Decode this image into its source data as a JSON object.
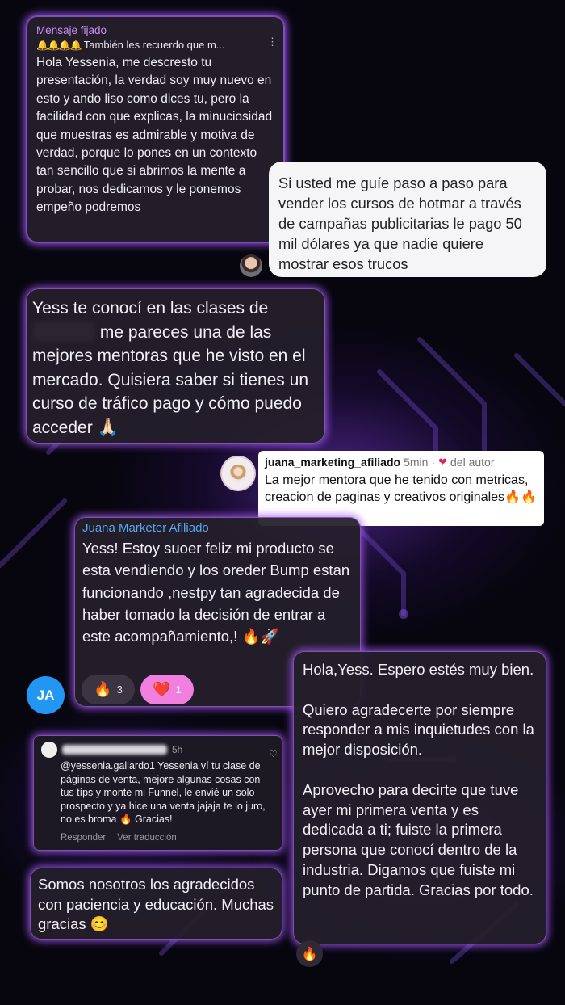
{
  "pinned": {
    "header": "Mensaje fijado",
    "bells": "🔔🔔🔔🔔",
    "preview": "También les recuerdo que m...",
    "more_icon": "⋮",
    "body": "Hola Yessenia, me descresto tu presentación, la verdad soy muy nuevo en esto y ando liso como dices tu, pero la facilidad con que explicas, la minuciosidad que muestras es admirable y motiva de verdad, porque lo pones en un contexto tan sencillo que si abrimos la mente a probar, nos dedicamos y le ponemos empeño podremos"
  },
  "question": {
    "text": "Si usted me guíe paso a paso para vender los cursos de hotmar a través de campañas publicitarias le pago 50 mil dólares ya que nadie quiere mostrar esos trucos"
  },
  "yess_message": {
    "before": "Yess te conocí en las clases de",
    "after": " me pareces una de las mejores mentoras que he visto en el mercado. Quisiera saber si tienes un curso de tráfico pago y cómo puedo acceder 🙏🏻"
  },
  "juana_comment": {
    "username": "juana_marketing_afiliado",
    "time": "5min",
    "dot": "·",
    "heart": "❤",
    "author_label": "del autor",
    "body": "La mejor mentora que he tenido con metricas, creacion de paginas y creativos originales🔥🔥"
  },
  "juana_message": {
    "name": "Juana Marketer Afiliado",
    "body": "Yess! Estoy suoer feliz mi producto se esta vendiendo y los oreder Bump estan funcionando ,nestpy tan agradecida de haber tomado la decisión de entrar a este acompañamiento,! 🔥🚀",
    "avatar_initials": "JA",
    "reactions": [
      {
        "emoji": "🔥",
        "count": "3"
      },
      {
        "emoji": "❤️",
        "count": "1"
      }
    ]
  },
  "hola_message": {
    "paragraphs": [
      "Hola,Yess. Espero estés muy bien.",
      "Quiero agradecerte por siempre responder a mis inquietudes con la mejor disposición.",
      "Aprovecho para decirte que tuve ayer mi primera venta y es dedicada a ti; fuiste la primera persona que conocí dentro de la industria. Digamos que fuiste mi punto de partida. Gracias por todo."
    ],
    "reaction": "🔥"
  },
  "yt_comment": {
    "time": "5h",
    "body": "@yessenia.gallardo1 Yessenia ví tu clase de páginas de venta, mejore algunas cosas con tus típs y monte mi Funnel, le envié un solo prospecto y ya hice una venta jajaja te lo juro, no es broma 🔥 Gracias!",
    "reply_label": "Responder",
    "translate_label": "Ver traducción",
    "heart": "♡"
  },
  "reply_message": {
    "text": "Somos nosotros los agradecidos con paciencia y educación. Muchas gracias 😊"
  },
  "colors": {
    "glow": "#aa5aff",
    "bubble": "#241f2c",
    "pinned_title": "#c98cf2",
    "juana_name": "#5aa8ef",
    "avatar_blue": "#2196f3",
    "heart_reaction": "#f07fe0"
  }
}
